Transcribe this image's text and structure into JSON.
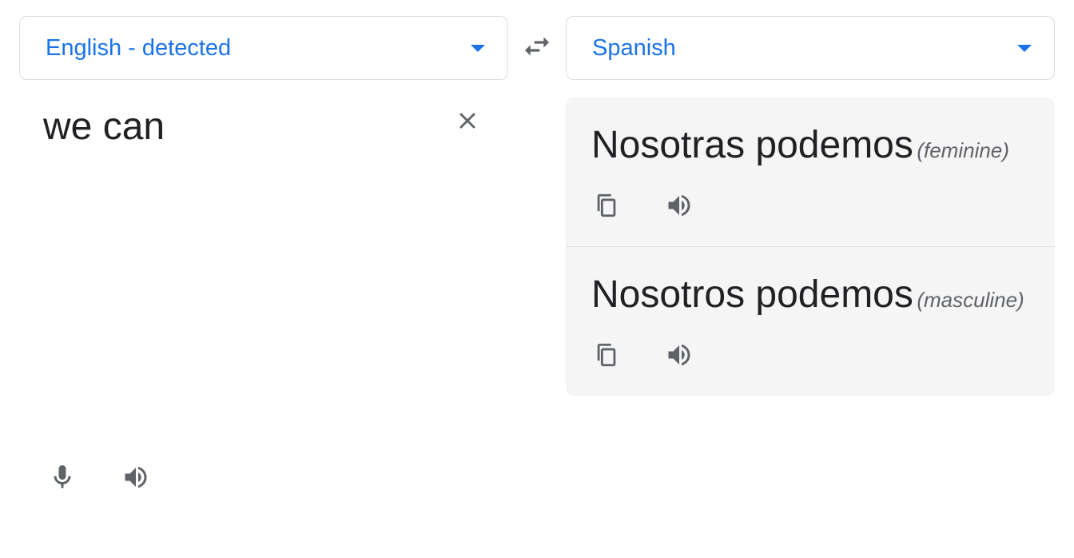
{
  "source": {
    "language": "English - detected",
    "text": "we can"
  },
  "target": {
    "language": "Spanish"
  },
  "results": [
    {
      "text": "Nosotras podemos",
      "gender": "(feminine)"
    },
    {
      "text": "Nosotros podemos",
      "gender": "(masculine)"
    }
  ]
}
